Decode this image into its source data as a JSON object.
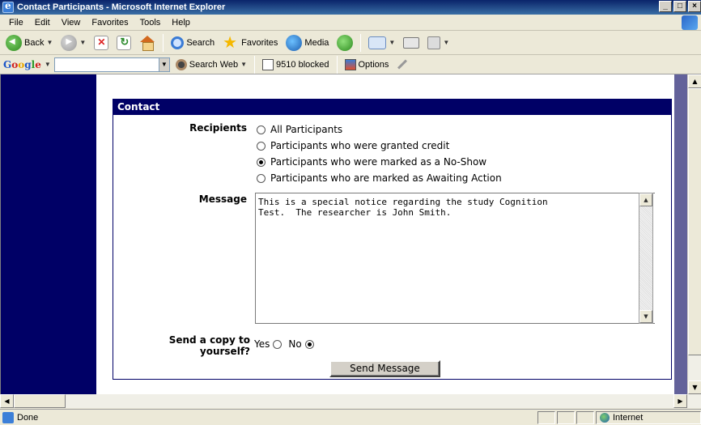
{
  "window": {
    "title": "Contact Participants - Microsoft Internet Explorer",
    "controls": [
      "_",
      "□",
      "×"
    ]
  },
  "menu": [
    "File",
    "Edit",
    "View",
    "Favorites",
    "Tools",
    "Help"
  ],
  "toolbar": {
    "back_label": "Back",
    "search_label": "Search",
    "favorites_label": "Favorites",
    "media_label": "Media"
  },
  "googlebar": {
    "logo": "Google",
    "search_web_label": "Search Web",
    "blocked_label": "9510 blocked",
    "options_label": "Options"
  },
  "form": {
    "header": "Contact",
    "recipients_label": "Recipients",
    "recipients_options": [
      {
        "label": "All Participants",
        "checked": false
      },
      {
        "label": "Participants who were granted credit",
        "checked": false
      },
      {
        "label": "Participants who were marked as a No-Show",
        "checked": true
      },
      {
        "label": "Participants who are marked as Awaiting Action",
        "checked": false
      }
    ],
    "message_label": "Message",
    "message_value": "This is a special notice regarding the study Cognition\nTest.  The researcher is John Smith.",
    "copy_label": "Send a copy to yourself?",
    "copy_yes": "Yes",
    "copy_no": "No",
    "copy_selected": "No",
    "send_button": "Send Message"
  },
  "statusbar": {
    "status": "Done",
    "zone": "Internet"
  },
  "colors": {
    "page_sidebar": "#000066",
    "frame_background": "#4b4a84",
    "header_background": "#000066"
  }
}
